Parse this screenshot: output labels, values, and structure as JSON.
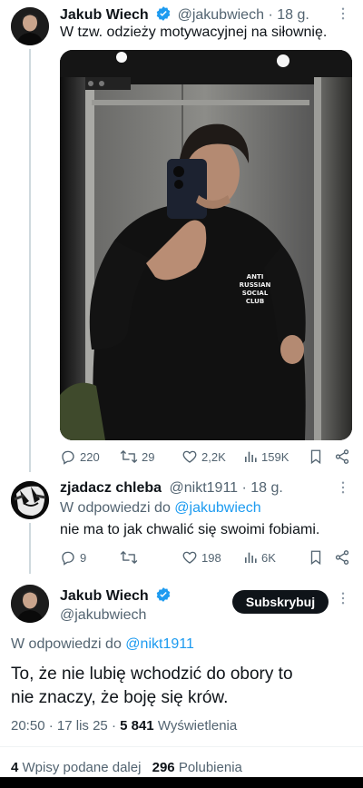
{
  "colors": {
    "accent": "#1d9bf0",
    "text": "#0f1419",
    "secondary": "#536471",
    "verified": "#1d9bf0"
  },
  "tweet1": {
    "name": "Jakub Wiech",
    "handle": "@jakubwiech",
    "separator": "·",
    "time": "18 g.",
    "text": "W tzw. odzieży motywacyjnej na siłownię.",
    "shirt_print": "ANTI RUSSIAN SOCIAL CLUB",
    "stats": {
      "replies": "220",
      "reposts": "29",
      "likes": "2,2K",
      "views": "159K"
    }
  },
  "tweet2": {
    "name": "zjadacz chleba",
    "handle": "@nikt1911",
    "separator": "·",
    "time": "18 g.",
    "reply_prefix": "W odpowiedzi do",
    "reply_to": "@jakubwiech",
    "text": "nie ma to jak chwalić się swoimi fobiami.",
    "stats": {
      "replies": "9",
      "reposts": "",
      "likes": "198",
      "views": "6K"
    }
  },
  "tweet3": {
    "name": "Jakub Wiech",
    "handle": "@jakubwiech",
    "subscribe_label": "Subskrybuj",
    "reply_prefix": "W odpowiedzi do",
    "reply_to": "@nikt1911",
    "text_line1": "To, że nie lubię wchodzić do obory to",
    "text_line2": "nie znaczy, że boję się krów.",
    "meta_time": "20:50",
    "meta_date": "17 lis 25",
    "meta_sep": "·",
    "views_count": "5 841",
    "views_label": "Wyświetlenia",
    "reposts_count": "4",
    "reposts_label": "Wpisy podane dalej",
    "likes_count": "296",
    "likes_label": "Polubienia"
  }
}
